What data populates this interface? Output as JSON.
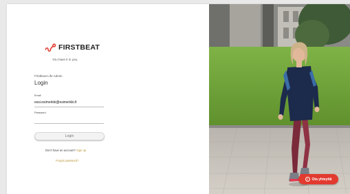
{
  "brand": {
    "name": "FIRSTBEAT",
    "tagline": "You have it in you.",
    "logo_color": "#e23a2f"
  },
  "form": {
    "subtitle": "Firstbeat Life Admin",
    "title": "Login",
    "email_label": "Email",
    "email_value": "essi.esimerkki@esimerkki.fi",
    "password_label": "Password",
    "login_label": "Login",
    "signup_prompt": "Don't have an account?",
    "signup_link": "Sign up",
    "forgot_link": "Forgot password?"
  },
  "contact": {
    "label": "Ota yhteyttä",
    "icon": "question-icon",
    "color": "#e23a2f"
  },
  "colors": {
    "accent": "#b89a3a",
    "button_bg": "#f3f3f3"
  }
}
